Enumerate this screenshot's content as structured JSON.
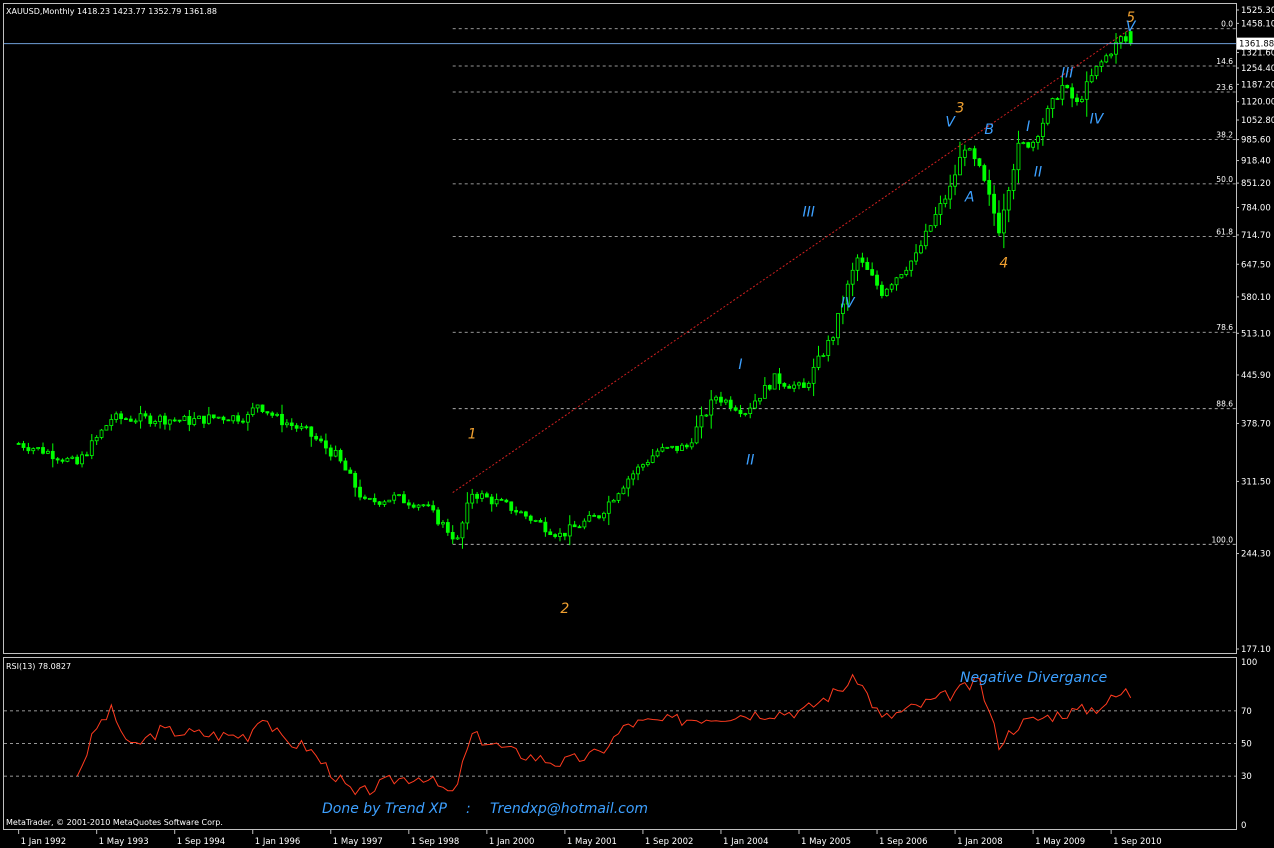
{
  "window": {
    "symbol_header": "XAUUSD,Monthly  1418.23 1423.77 1352.79 1361.88",
    "rsi_header": "RSI(13) 78.0827",
    "copyright": "MetaTrader, © 2001-2010 MetaQuotes Software Corp.",
    "current_price_label": "1361.88"
  },
  "colors": {
    "background": "#000000",
    "candle": "#00ff00",
    "rsi_line": "#ff3b1f",
    "fib_line": "#c8c8c8",
    "trend_line": "#d02020",
    "current_price_line": "#6f9fd8",
    "wave_primary": "#f0a030",
    "wave_secondary": "#3da0ff"
  },
  "chart_data": [
    {
      "type": "candlestick",
      "title": "XAUUSD,Monthly",
      "ohlc_last": {
        "open": 1418.23,
        "high": 1423.77,
        "low": 1352.79,
        "close": 1361.88
      },
      "ylim": [
        177.1,
        1525.3
      ],
      "y_ticks": [
        "1525.30",
        "1458.10",
        "1390.90",
        "1321.60",
        "1254.40",
        "1187.20",
        "1120.00",
        "1052.80",
        "985.60",
        "918.40",
        "851.20",
        "784.00",
        "714.70",
        "647.50",
        "580.10",
        "513.10",
        "445.90",
        "378.70",
        "311.50",
        "244.30",
        "177.10"
      ],
      "x_ticks": [
        "1 Jan 1992",
        "1 May 1993",
        "1 Sep 1994",
        "1 Jan 1996",
        "1 May 1997",
        "1 Sep 1998",
        "1 Jan 2000",
        "1 May 2001",
        "1 Sep 2002",
        "1 Jan 2004",
        "1 May 2005",
        "1 Sep 2006",
        "1 Jan 2008",
        "1 May 2009",
        "1 Sep 2010"
      ],
      "close_path": [
        [
          "1992-01",
          354
        ],
        [
          "1992-07",
          344
        ],
        [
          "1993-01",
          330
        ],
        [
          "1993-05",
          360
        ],
        [
          "1993-08",
          385
        ],
        [
          "1993-12",
          385
        ],
        [
          "1994-06",
          385
        ],
        [
          "1994-12",
          382
        ],
        [
          "1995-06",
          387
        ],
        [
          "1995-12",
          387
        ],
        [
          "1996-02",
          405
        ],
        [
          "1996-06",
          385
        ],
        [
          "1996-12",
          368
        ],
        [
          "1997-06",
          340
        ],
        [
          "1997-12",
          290
        ],
        [
          "1998-06",
          295
        ],
        [
          "1998-12",
          288
        ],
        [
          "1999-07",
          255
        ],
        [
          "1999-10",
          300
        ],
        [
          "2000-06",
          285
        ],
        [
          "2001-04",
          260
        ],
        [
          "2001-12",
          278
        ],
        [
          "2002-06",
          315
        ],
        [
          "2002-12",
          345
        ],
        [
          "2003-06",
          350
        ],
        [
          "2003-12",
          415
        ],
        [
          "2004-06",
          395
        ],
        [
          "2004-12",
          440
        ],
        [
          "2005-06",
          425
        ],
        [
          "2005-12",
          510
        ],
        [
          "2006-05",
          660
        ],
        [
          "2006-10",
          590
        ],
        [
          "2007-05",
          665
        ],
        [
          "2007-12",
          835
        ],
        [
          "2008-03",
          965
        ],
        [
          "2008-06",
          890
        ],
        [
          "2008-10",
          730
        ],
        [
          "2009-02",
          960
        ],
        [
          "2009-05",
          980
        ],
        [
          "2009-11",
          1180
        ],
        [
          "2010-02",
          1110
        ],
        [
          "2010-06",
          1250
        ],
        [
          "2010-11",
          1385
        ],
        [
          "2011-01",
          1361.88
        ]
      ],
      "fibonacci_levels": [
        {
          "label": "0.0",
          "price": 1432
        },
        {
          "label": "14.6",
          "price": 1263
        },
        {
          "label": "23.6",
          "price": 1157
        },
        {
          "label": "38.2",
          "price": 986
        },
        {
          "label": "50.0",
          "price": 849
        },
        {
          "label": "61.8",
          "price": 711
        },
        {
          "label": "78.6",
          "price": 515
        },
        {
          "label": "88.6",
          "price": 398
        },
        {
          "label": "100.0",
          "price": 252
        }
      ],
      "trend_line": [
        [
          "1999-06",
          300
        ],
        [
          "2011-01",
          1432
        ]
      ],
      "current_price": 1361.88,
      "wave_labels": [
        {
          "text": "1",
          "t": "1999-10",
          "price": 360,
          "group": "primary"
        },
        {
          "text": "2",
          "t": "2001-05",
          "price": 200,
          "group": "primary"
        },
        {
          "text": "3",
          "t": "2008-02",
          "price": 1080,
          "group": "primary"
        },
        {
          "text": "4",
          "t": "2008-11",
          "price": 640,
          "group": "primary"
        },
        {
          "text": "5",
          "t": "2011-01",
          "price": 1465,
          "group": "primary"
        },
        {
          "text": "I",
          "t": "2004-05",
          "price": 455,
          "group": "secondary"
        },
        {
          "text": "II",
          "t": "2004-07",
          "price": 330,
          "group": "secondary"
        },
        {
          "text": "III",
          "t": "2005-07",
          "price": 760,
          "group": "secondary"
        },
        {
          "text": "IV",
          "t": "2006-03",
          "price": 560,
          "group": "secondary"
        },
        {
          "text": "V",
          "t": "2007-12",
          "price": 1030,
          "group": "secondary"
        },
        {
          "text": "A",
          "t": "2008-04",
          "price": 800,
          "group": "secondary"
        },
        {
          "text": "B",
          "t": "2008-08",
          "price": 1005,
          "group": "secondary"
        },
        {
          "text": "I",
          "t": "2009-04",
          "price": 1015,
          "group": "secondary"
        },
        {
          "text": "II",
          "t": "2009-06",
          "price": 870,
          "group": "secondary"
        },
        {
          "text": "III",
          "t": "2009-12",
          "price": 1215,
          "group": "secondary"
        },
        {
          "text": "IV",
          "t": "2010-06",
          "price": 1040,
          "group": "secondary"
        },
        {
          "text": "V",
          "t": "2011-01",
          "price": 1420,
          "group": "secondary"
        }
      ]
    },
    {
      "type": "line",
      "title": "RSI(13) 78.0827",
      "ylim": [
        0,
        100
      ],
      "y_ticks": [
        100,
        70,
        50,
        30,
        0
      ],
      "levels": [
        70,
        50,
        30
      ],
      "last_value": 78.0827,
      "series": [
        {
          "values": [
            [
              "1993-01",
              30
            ],
            [
              "1993-05",
              60
            ],
            [
              "1993-08",
              70
            ],
            [
              "1993-12",
              47
            ],
            [
              "1994-06",
              58
            ],
            [
              "1995-06",
              55
            ],
            [
              "1995-12",
              55
            ],
            [
              "1996-03",
              68
            ],
            [
              "1996-07",
              52
            ],
            [
              "1996-12",
              48
            ],
            [
              "1997-06",
              30
            ],
            [
              "1997-10",
              18
            ],
            [
              "1998-06",
              28
            ],
            [
              "1998-12",
              30
            ],
            [
              "1999-06",
              18
            ],
            [
              "1999-10",
              55
            ],
            [
              "2000-06",
              45
            ],
            [
              "2001-04",
              38
            ],
            [
              "2001-12",
              44
            ],
            [
              "2002-06",
              62
            ],
            [
              "2003-06",
              65
            ],
            [
              "2004-06",
              68
            ],
            [
              "2005-06",
              70
            ],
            [
              "2006-05",
              90
            ],
            [
              "2006-10",
              65
            ],
            [
              "2007-12",
              80
            ],
            [
              "2008-06",
              88
            ],
            [
              "2008-10",
              50
            ],
            [
              "2009-02",
              62
            ],
            [
              "2009-10",
              68
            ],
            [
              "2010-06",
              72
            ],
            [
              "2010-12",
              82
            ],
            [
              "2011-01",
              78
            ]
          ]
        }
      ]
    }
  ],
  "annotations": {
    "divergence_note": "Negative Divergance",
    "credit": "Done by Trend XP",
    "separator": ":",
    "email": "Trendxp@hotmail.com"
  }
}
